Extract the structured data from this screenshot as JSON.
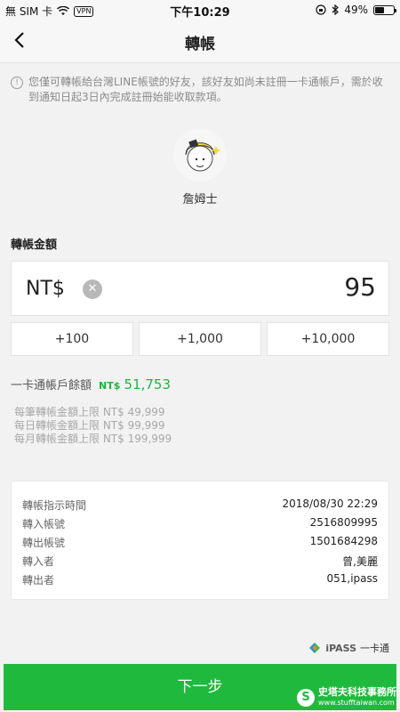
{
  "status_bar": {
    "carrier": "無 SIM 卡",
    "vpn": "VPN",
    "time": "下午10:29",
    "battery": "49%",
    "battery_level": 0.49
  },
  "nav": {
    "title": "轉帳"
  },
  "notice": "您僅可轉帳給台灣LINE帳號的好友，該好友如尚未註冊一卡通帳戶，需於收到通知日起3日內完成註冊始能收取款項。",
  "recipient": {
    "name": "詹姆士"
  },
  "amount": {
    "section_label": "轉帳金額",
    "currency": "NT$",
    "value": "95",
    "quick_adds": [
      "+100",
      "+1,000",
      "+10,000"
    ]
  },
  "balance": {
    "label": "一卡通帳戶餘額",
    "currency": "NT$",
    "value": "51,753"
  },
  "limits": [
    "每筆轉帳金額上限 NT$ 49,999",
    "每日轉帳金額上限 NT$ 99,999",
    "每月轉帳金額上限 NT$ 199,999"
  ],
  "details": [
    {
      "label": "轉帳指示時間",
      "value": "2018/08/30 22:29"
    },
    {
      "label": "轉入帳號",
      "value": "2516809995"
    },
    {
      "label": "轉出帳號",
      "value": "1501684298"
    },
    {
      "label": "轉入者",
      "value": "曾,美麗"
    },
    {
      "label": "轉出者",
      "value": "051,ipass"
    }
  ],
  "ipass": {
    "logo": "iPASS",
    "text": "一卡通"
  },
  "next_button": "下一步",
  "watermark": {
    "main": "史塔夫科技事務所",
    "url": "www.stufftaiwan.com"
  },
  "colors": {
    "accent": "#1fba3d",
    "balance": "#1eb43c"
  }
}
